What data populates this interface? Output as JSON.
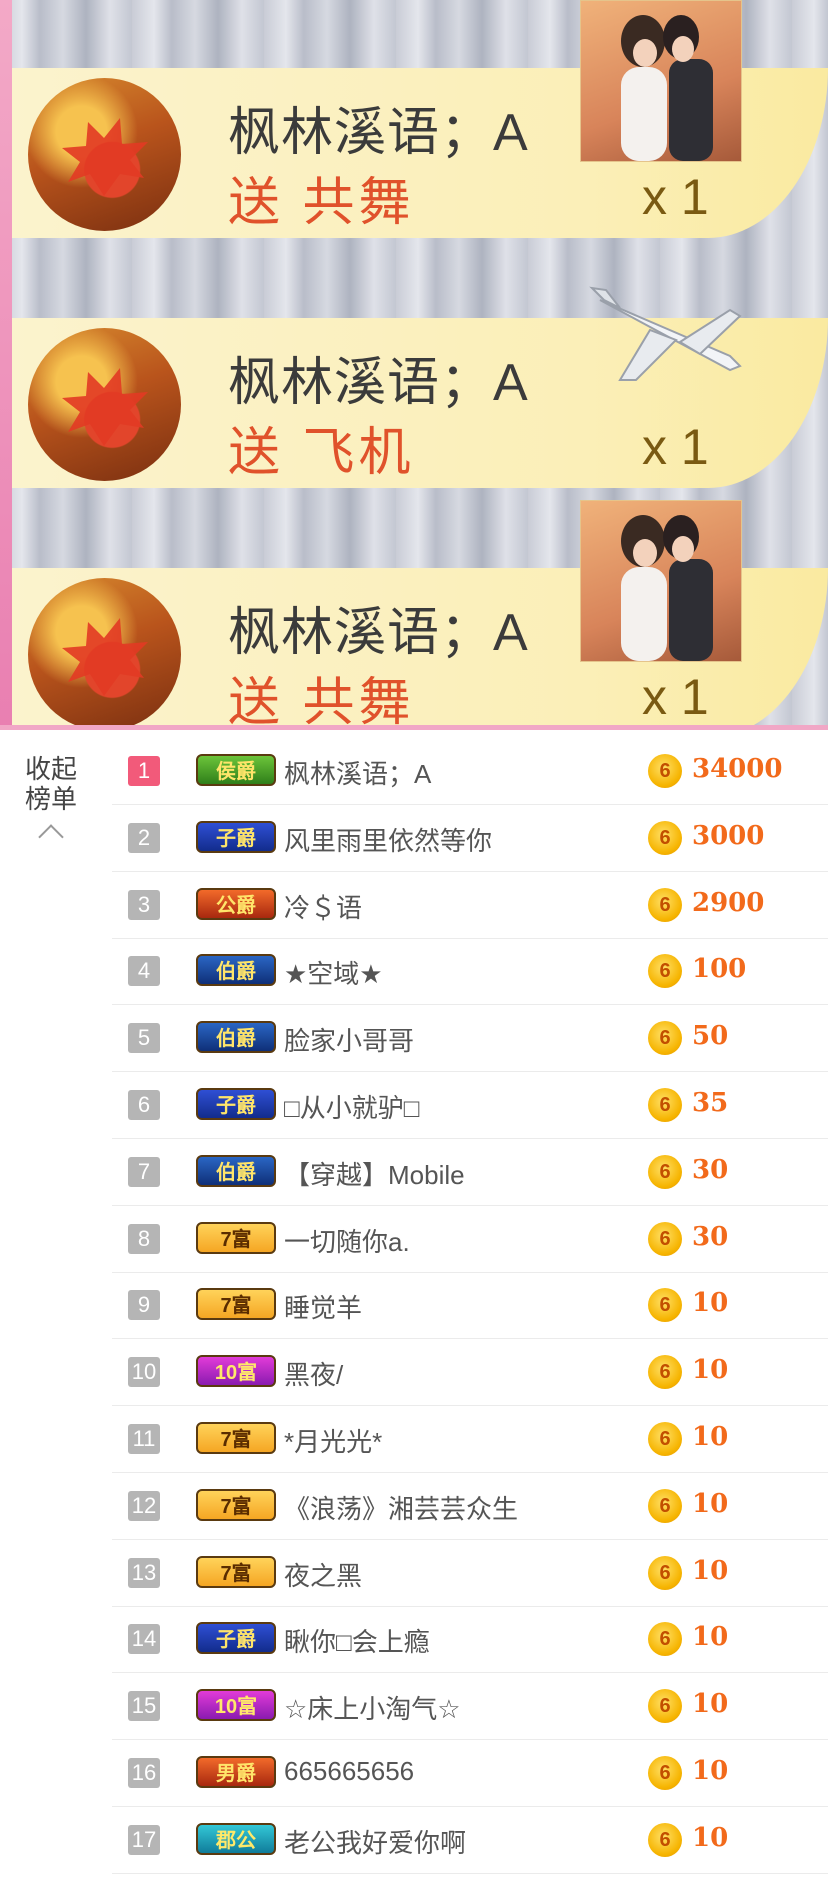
{
  "gift_messages": [
    {
      "sender": "枫林溪语；A",
      "action": "送 共舞",
      "count": "x 1",
      "gift": "couple-dance-icon"
    },
    {
      "sender": "枫林溪语；A",
      "action": "送 飞机",
      "count": "x 1",
      "gift": "airplane-icon"
    },
    {
      "sender": "枫林溪语；A",
      "action": "送 共舞",
      "count": "x 1",
      "gift": "couple-dance-icon"
    }
  ],
  "ranking": {
    "collapse_label": "收起榜单",
    "coin_label": "6",
    "rows": [
      {
        "rank": "1",
        "badge": "侯爵",
        "name": "枫林溪语；A",
        "amount": "34000"
      },
      {
        "rank": "2",
        "badge": "子爵",
        "name": "风里雨里依然等你",
        "amount": "3000"
      },
      {
        "rank": "3",
        "badge": "公爵",
        "name": "冷＄语",
        "amount": "2900"
      },
      {
        "rank": "4",
        "badge": "伯爵",
        "name": "★空域★",
        "amount": "100"
      },
      {
        "rank": "5",
        "badge": "伯爵",
        "name": "脸家小哥哥",
        "amount": "50"
      },
      {
        "rank": "6",
        "badge": "子爵",
        "name": "□从小就驴□",
        "amount": "35"
      },
      {
        "rank": "7",
        "badge": "伯爵",
        "name": "【穿越】Mobile",
        "amount": "30"
      },
      {
        "rank": "8",
        "badge": "7富",
        "name": "一切随你a.",
        "amount": "30"
      },
      {
        "rank": "9",
        "badge": "7富",
        "name": "睡觉羊",
        "amount": "10"
      },
      {
        "rank": "10",
        "badge": "10富",
        "name": "黑夜/",
        "amount": "10"
      },
      {
        "rank": "11",
        "badge": "7富",
        "name": "*月光光*",
        "amount": "10"
      },
      {
        "rank": "12",
        "badge": "7富",
        "name": "《浪荡》湘芸芸众生",
        "amount": "10"
      },
      {
        "rank": "13",
        "badge": "7富",
        "name": "夜之黑",
        "amount": "10"
      },
      {
        "rank": "14",
        "badge": "子爵",
        "name": "瞅你□会上瘾",
        "amount": "10"
      },
      {
        "rank": "15",
        "badge": "10富",
        "name": "☆床上小淘气☆",
        "amount": "10"
      },
      {
        "rank": "16",
        "badge": "男爵",
        "name": "665665656",
        "amount": "10"
      },
      {
        "rank": "17",
        "badge": "郡公",
        "name": "老公我好爱你啊",
        "amount": "10"
      }
    ]
  }
}
